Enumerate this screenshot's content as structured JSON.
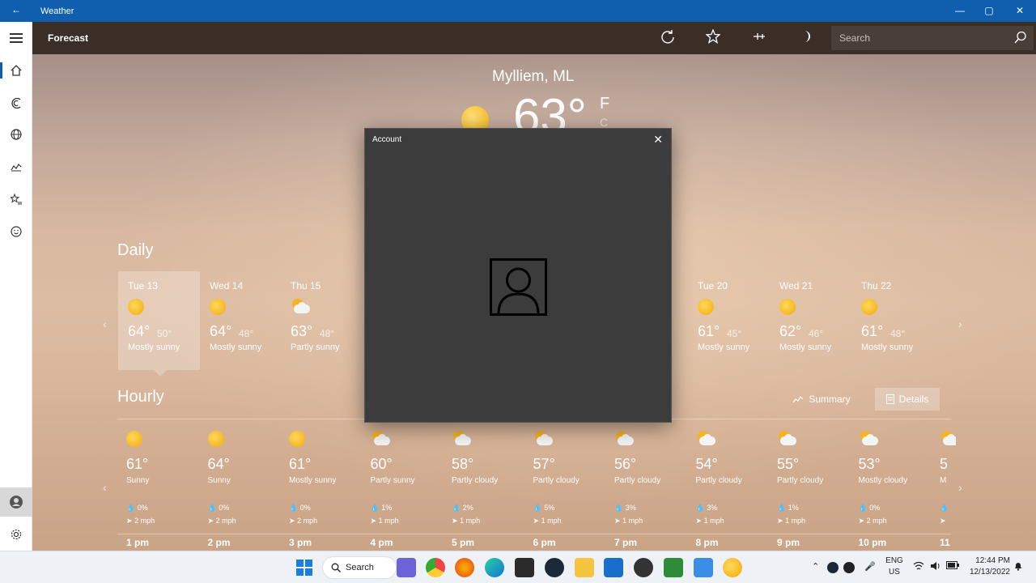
{
  "window": {
    "title": "Weather",
    "back_icon": "back-arrow-icon",
    "minimize_glyph": "—",
    "maximize_glyph": "▢",
    "close_glyph": "✕"
  },
  "command_bar": {
    "page_title": "Forecast",
    "search_placeholder": "Search"
  },
  "current": {
    "location": "Mylliem, ML",
    "temperature": "63°",
    "unit_f": "F",
    "unit_c": "C"
  },
  "daily": {
    "heading": "Daily",
    "days": [
      {
        "day": "Tue 13",
        "icon": "sun",
        "hi": "64°",
        "lo": "50°",
        "cond": "Mostly sunny"
      },
      {
        "day": "Wed 14",
        "icon": "sun",
        "hi": "64°",
        "lo": "48°",
        "cond": "Mostly sunny"
      },
      {
        "day": "Thu 15",
        "icon": "cloudsun",
        "hi": "63°",
        "lo": "48°",
        "cond": "Partly sunny"
      },
      {
        "day": "Tue 20",
        "icon": "sun",
        "hi": "61°",
        "lo": "45°",
        "cond": "Mostly sunny"
      },
      {
        "day": "Wed 21",
        "icon": "sun",
        "hi": "62°",
        "lo": "46°",
        "cond": "Mostly sunny"
      },
      {
        "day": "Thu 22",
        "icon": "sun",
        "hi": "61°",
        "lo": "48°",
        "cond": "Mostly sunny"
      }
    ]
  },
  "hourly": {
    "heading": "Hourly",
    "summary_label": "Summary",
    "details_label": "Details",
    "hours": [
      {
        "time": "1 pm",
        "icon": "sun",
        "temp": "61°",
        "cond": "Sunny",
        "precip": "0%",
        "wind": "2 mph"
      },
      {
        "time": "2 pm",
        "icon": "sun",
        "temp": "64°",
        "cond": "Sunny",
        "precip": "0%",
        "wind": "2 mph"
      },
      {
        "time": "3 pm",
        "icon": "sun",
        "temp": "61°",
        "cond": "Mostly sunny",
        "precip": "0%",
        "wind": "2 mph"
      },
      {
        "time": "4 pm",
        "icon": "cloudsun",
        "temp": "60°",
        "cond": "Partly sunny",
        "precip": "1%",
        "wind": "1 mph"
      },
      {
        "time": "5 pm",
        "icon": "cloudsun",
        "temp": "58°",
        "cond": "Partly cloudy",
        "precip": "2%",
        "wind": "1 mph"
      },
      {
        "time": "6 pm",
        "icon": "cloudsun",
        "temp": "57°",
        "cond": "Partly cloudy",
        "precip": "5%",
        "wind": "1 mph"
      },
      {
        "time": "7 pm",
        "icon": "cloudsun",
        "temp": "56°",
        "cond": "Partly cloudy",
        "precip": "3%",
        "wind": "1 mph"
      },
      {
        "time": "8 pm",
        "icon": "cloudsun",
        "temp": "54°",
        "cond": "Partly cloudy",
        "precip": "3%",
        "wind": "1 mph"
      },
      {
        "time": "9 pm",
        "icon": "cloudsun",
        "temp": "55°",
        "cond": "Partly cloudy",
        "precip": "1%",
        "wind": "1 mph"
      },
      {
        "time": "10 pm",
        "icon": "cloudsun",
        "temp": "53°",
        "cond": "Mostly cloudy",
        "precip": "0%",
        "wind": "2 mph"
      },
      {
        "time": "11",
        "icon": "cloudsun",
        "temp": "5",
        "cond": "M",
        "precip": "",
        "wind": ""
      }
    ]
  },
  "dialog": {
    "title": "Account",
    "close_glyph": "✕"
  },
  "taskbar": {
    "search_label": "Search",
    "lang_top": "ENG",
    "lang_bottom": "US",
    "time": "12:44 PM",
    "date": "12/13/2022"
  },
  "colors": {
    "titlebar": "#0f5fae",
    "accent_sun": "#f2a90a"
  }
}
